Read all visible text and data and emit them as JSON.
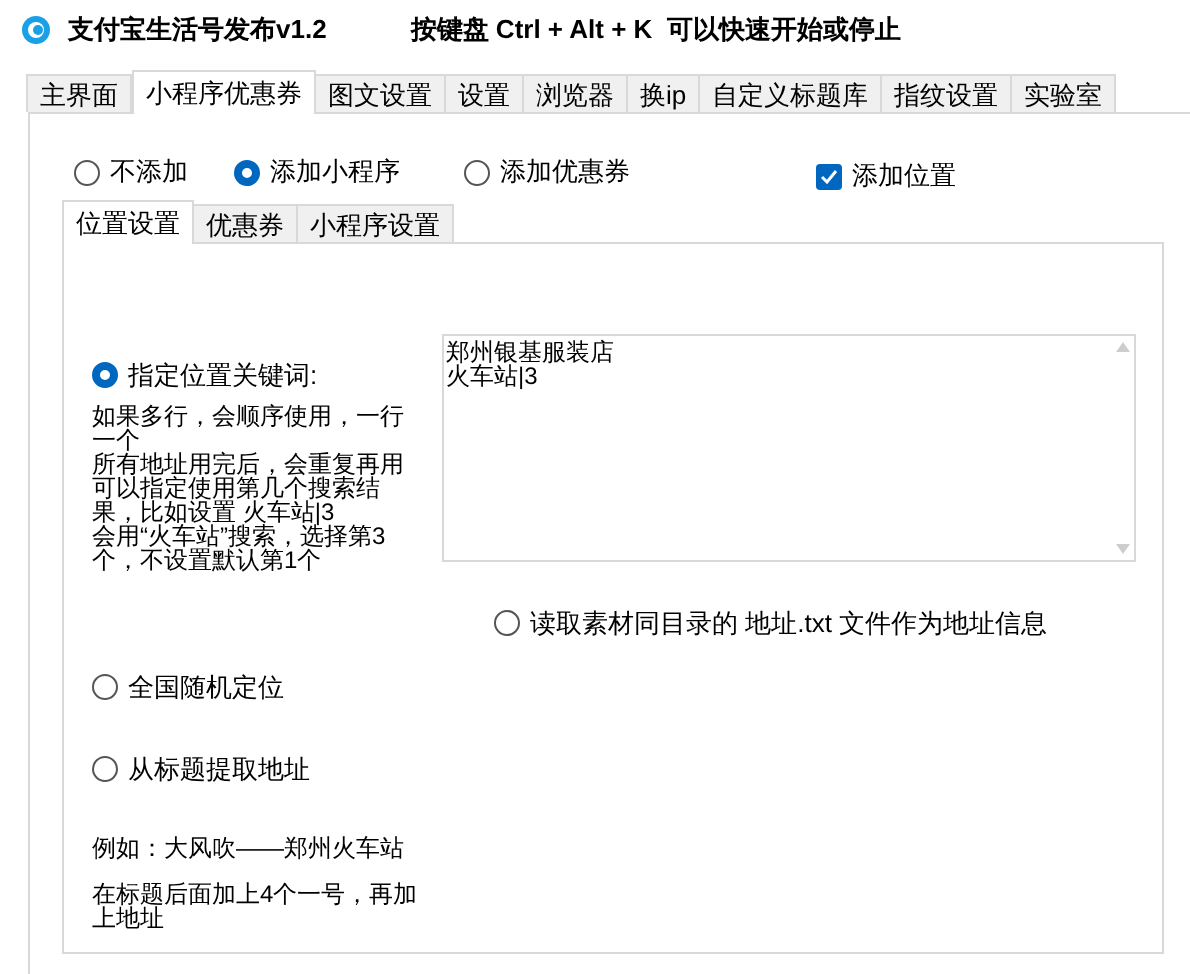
{
  "window": {
    "title": "支付宝生活号发布v1.2",
    "hint": "按键盘 Ctrl + Alt + K  可以快速开始或停止"
  },
  "tabs": [
    {
      "label": "主界面",
      "selected": false
    },
    {
      "label": "小程序优惠券",
      "selected": true
    },
    {
      "label": "图文设置",
      "selected": false
    },
    {
      "label": "设置",
      "selected": false
    },
    {
      "label": "浏览器",
      "selected": false
    },
    {
      "label": "换ip",
      "selected": false
    },
    {
      "label": "自定义标题库",
      "selected": false
    },
    {
      "label": "指纹设置",
      "selected": false
    },
    {
      "label": "实验室",
      "selected": false
    }
  ],
  "mode_options": [
    {
      "label": "不添加",
      "selected": false
    },
    {
      "label": "添加小程序",
      "selected": true
    },
    {
      "label": "添加优惠券",
      "selected": false
    }
  ],
  "add_location": {
    "label": "添加位置",
    "checked": true
  },
  "sub_tabs": [
    {
      "label": "位置设置",
      "selected": true
    },
    {
      "label": "优惠券",
      "selected": false
    },
    {
      "label": "小程序设置",
      "selected": false
    }
  ],
  "location": {
    "keyword_option": {
      "label": "指定位置关键词:",
      "selected": true
    },
    "keyword_help": [
      "如果多行，会顺序使用，一行一个",
      "所有地址用完后，会重复再用",
      "可以指定使用第几个搜索结果，比如设置 火车站|3",
      "会用“火车站”搜索，选择第3个，不设置默认第1个"
    ],
    "keywords_lines": [
      "郑州银基服装店",
      "火车站|3"
    ],
    "file_option": {
      "label": "读取素材同目录的 地址.txt 文件作为地址信息",
      "selected": false
    },
    "random_option": {
      "label": "全国随机定位",
      "selected": false
    },
    "title_option": {
      "label": "从标题提取地址",
      "selected": false
    },
    "title_help": [
      "例如：大风吹——郑州火车站",
      "在标题后面加上4个一号，再加上地址"
    ]
  }
}
